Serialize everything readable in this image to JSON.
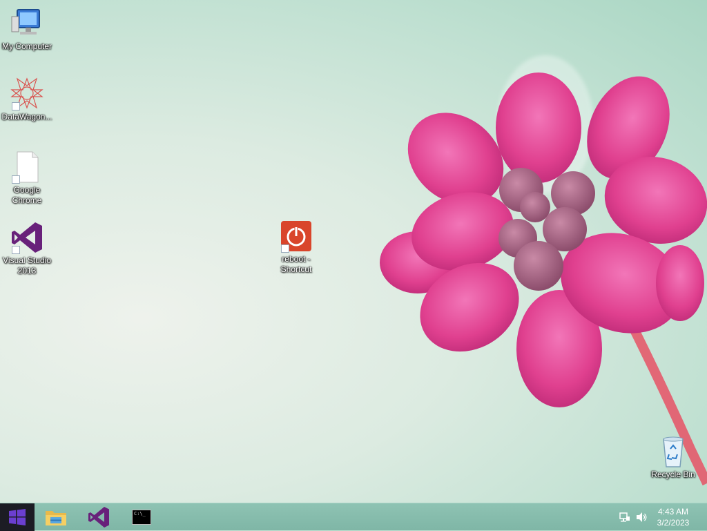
{
  "desktop": {
    "icons": [
      {
        "label": "My Computer"
      },
      {
        "label": "DataWagon..."
      },
      {
        "label": "Google Chrome"
      },
      {
        "label": "Visual Studio 2013"
      },
      {
        "label": "reboot - Shortcut"
      },
      {
        "label": "Recycle Bin"
      }
    ]
  },
  "taskbar": {
    "pinned": [
      {
        "icon": "file-explorer-icon"
      },
      {
        "icon": "visual-studio-icon"
      },
      {
        "icon": "command-prompt-icon"
      }
    ],
    "cmd_prompt_text": "C:\\_",
    "tray": {
      "network_icon": "network-icon",
      "volume_icon": "speaker-icon"
    },
    "clock": {
      "time": "4:43 AM",
      "date": "3/2/2023"
    }
  },
  "colors": {
    "start_bg": "#1c1c24",
    "windows_logo": "#6b3fd0",
    "vs_purple": "#68217a",
    "reboot_red": "#d9452b",
    "flower_pink": "#e8479a"
  }
}
